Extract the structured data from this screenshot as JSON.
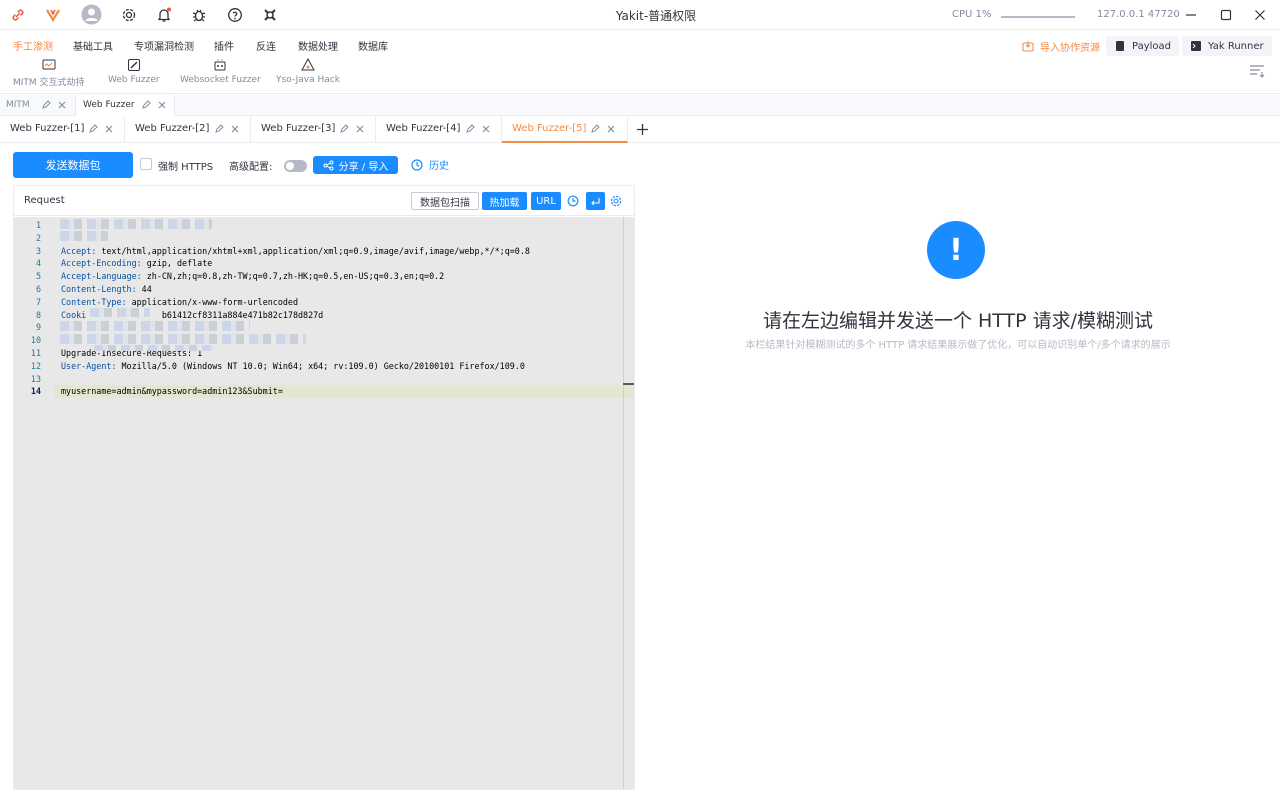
{
  "window": {
    "title": "Yakit-普通权限",
    "cpu": "CPU 1%",
    "host": "127.0.0.1 47720"
  },
  "menu": {
    "items": [
      "手工渗测",
      "基础工具",
      "专项漏洞检测",
      "插件",
      "反连",
      "数据处理",
      "数据库"
    ],
    "active_index": 0,
    "sub_items": [
      "MITM 交互式劫持",
      "Web Fuzzer",
      "Websocket Fuzzer",
      "Yso-Java Hack"
    ],
    "import_label": "导入协作资源",
    "payload_label": "Payload",
    "runner_label": "Yak Runner"
  },
  "page_tabs": [
    "MITM",
    "Web Fuzzer"
  ],
  "sub_tabs": [
    "Web Fuzzer-[1]",
    "Web Fuzzer-[2]",
    "Web Fuzzer-[3]",
    "Web Fuzzer-[4]",
    "Web Fuzzer-[5]"
  ],
  "toolbar": {
    "send_label": "发送数据包",
    "https_label": "强制 HTTPS",
    "advanced_label": "高级配置:",
    "share_label": "分享 / 导入",
    "history_label": "历史"
  },
  "request": {
    "title": "Request",
    "btn_scan": "数据包扫描",
    "btn_hot": "热加载",
    "btn_url": "URL",
    "lines": [
      {
        "n": "1",
        "key": "",
        "val": ""
      },
      {
        "n": "2",
        "key": "",
        "val": ""
      },
      {
        "n": "3",
        "key": "Accept:",
        "val": " text/html,application/xhtml+xml,application/xml;q=0.9,image/avif,image/webp,*/*;q=0.8"
      },
      {
        "n": "4",
        "key": "Accept-Encoding:",
        "val": " gzip, deflate"
      },
      {
        "n": "5",
        "key": "Accept-Language:",
        "val": " zh-CN,zh;q=0.8,zh-TW;q=0.7,zh-HK;q=0.5,en-US;q=0.3,en;q=0.2"
      },
      {
        "n": "6",
        "key": "Content-Length:",
        "val": " 44"
      },
      {
        "n": "7",
        "key": "Content-Type:",
        "val": " application/x-www-form-urlencoded"
      },
      {
        "n": "8",
        "key": "Cooki",
        "val": "               b61412cf8311a884e471b82c178d827d"
      },
      {
        "n": "9",
        "key": "",
        "val": ""
      },
      {
        "n": "10",
        "key": "",
        "val": ""
      },
      {
        "n": "11",
        "key": "",
        "val": "Upgrade-Insecure-Requests: 1"
      },
      {
        "n": "12",
        "key": "User-Agent:",
        "val": " Mozilla/5.0 (Windows NT 10.0; Win64; x64; rv:109.0) Gecko/20100101 Firefox/109.0"
      },
      {
        "n": "13",
        "key": "",
        "val": ""
      },
      {
        "n": "14",
        "key": "",
        "val": "myusername=admin&mypassword=admin123&Submit="
      }
    ]
  },
  "empty_state": {
    "icon": "!",
    "title": "请在左边编辑并发送一个 HTTP 请求/模糊测试",
    "subtitle": "本栏结果针对模糊测试的多个 HTTP 请求结果展示做了优化，可以自动识别单个/多个请求的展示"
  },
  "colors": {
    "accent": "#1b8cff",
    "active_tab": "#f28b44",
    "editor_bg": "#e8e8e8"
  }
}
